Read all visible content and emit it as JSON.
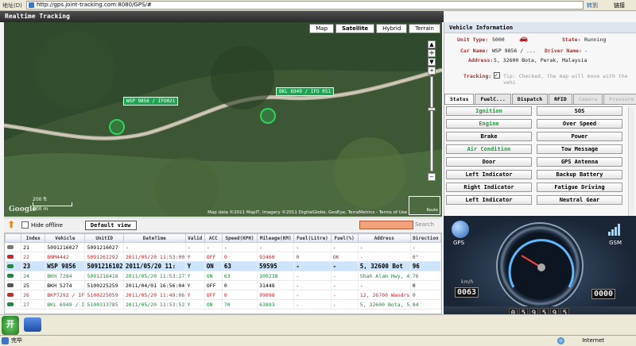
{
  "browser": {
    "address_label": "地址(D)",
    "url": "http://gps.joint-tracking.com:8080/GPS/#",
    "go_label": "转到",
    "links_label": "链接"
  },
  "app": {
    "title": "Realtime Tracking",
    "map_types": [
      "Map",
      "Satellite",
      "Hybrid",
      "Terrain"
    ],
    "map_type_selected": "Satellite",
    "map_vehicles": [
      {
        "label": "WSP 9856 / IFO021"
      },
      {
        "label": "BKL 6949 / IFO 051"
      }
    ],
    "map_scale": {
      "top": "200 ft",
      "bottom": "100 m"
    },
    "map_credit": "Map data ©2011 MapIT, Imagery ©2011 DigitalGlobe, GeoEye, TerraMetrics - Terms of Use",
    "google_logo": "Google",
    "overview_label": "Route"
  },
  "grid": {
    "hide_offline_label": "Hide offline",
    "default_view_label": "Default view",
    "search_label": "Search",
    "columns": [
      "Index",
      "Vehicle",
      "UnitID",
      "DateTime",
      "Valid",
      "ACC",
      "Speed(KPH)",
      "Mileage(KM)",
      "Fuel(Litre)",
      "Fuel(%)",
      "Address",
      "Direction"
    ],
    "rows": [
      {
        "style": "normal",
        "car": "#777777",
        "cells": [
          "21",
          "5091216027",
          "5091216027",
          "-",
          "-",
          "-",
          "-",
          "-",
          "-",
          "-",
          "-",
          "-"
        ]
      },
      {
        "style": "red",
        "car": "#c4282a",
        "cells": [
          "22",
          "BNM4442",
          "5091262292",
          "2011/05/20 11:53:00",
          "Y",
          "OFF",
          "0",
          "93460",
          "0",
          "OK",
          "-",
          "0°"
        ]
      },
      {
        "style": "sel",
        "car": "#1c8a3a",
        "cells": [
          "23",
          "WSP 9856",
          "5091216102",
          "2011/05/20 11:",
          "Y",
          "ON",
          "63",
          "59595",
          "-",
          "-",
          "5, 32600 Bot",
          "96"
        ]
      },
      {
        "style": "green",
        "car": "#1c8a3a",
        "cells": [
          "24",
          "BKH 7284",
          "5091216418",
          "2011/05/20 11:53:27",
          "Y",
          "ON",
          "63",
          "100238",
          "-",
          "-",
          "Shah Alam Hwy, 4",
          "76"
        ]
      },
      {
        "style": "normal",
        "car": "#555555",
        "cells": [
          "25",
          "BKH 5274",
          "5100225259",
          "2011/04/01 16:56:04",
          "Y",
          "OFF",
          "0",
          "31448",
          "-",
          "-",
          "-",
          "0"
        ]
      },
      {
        "style": "red",
        "car": "#c4282a",
        "cells": [
          "26",
          "BKP7292 / IF",
          "5100225059",
          "2011/05/20 11:49:06",
          "Y",
          "OFF",
          "0",
          "99098",
          "-",
          "-",
          "12, 26700 Wandrs",
          "0"
        ]
      },
      {
        "style": "green",
        "car": "#1c8a3a",
        "cells": [
          "27",
          "BKL 6949 / I",
          "5100313785",
          "2011/05/20 11:53:52",
          "Y",
          "ON",
          "70",
          "63883",
          "-",
          "-",
          "5, 32600 Bota, 5",
          "84"
        ]
      }
    ]
  },
  "vehicle_info": {
    "heading": "Vehicle Information",
    "unit_type_key": "Unit Type:",
    "unit_type_val": "5000",
    "state_key": "State:",
    "state_val": "Running",
    "car_name_key": "Car Name:",
    "car_name_val": "WSP 9856 / ...",
    "driver_name_key": "Driver Name:",
    "driver_name_val": "-",
    "address_key": "Address:",
    "address_val": "5, 32600 Bota, Perak, Malaysia",
    "tracking_key": "Tracking:",
    "tracking_tip": "Tip: Checked, the map will move with the vehi"
  },
  "tabs": [
    {
      "label": "Status",
      "state": "on"
    },
    {
      "label": "FuelC...",
      "state": "off"
    },
    {
      "label": "Dispatch",
      "state": "off"
    },
    {
      "label": "RFID",
      "state": "off"
    },
    {
      "label": "Camera",
      "state": "dis"
    },
    {
      "label": "Pressure",
      "state": "dis"
    }
  ],
  "status_items": [
    {
      "label": "Ignition",
      "active": true
    },
    {
      "label": "SOS",
      "active": false
    },
    {
      "label": "Engine",
      "active": true
    },
    {
      "label": "Over Speed",
      "active": false
    },
    {
      "label": "Brake",
      "active": false
    },
    {
      "label": "Power",
      "active": false
    },
    {
      "label": "Air Condition",
      "active": true
    },
    {
      "label": "Tow Message",
      "active": false
    },
    {
      "label": "Door",
      "active": false
    },
    {
      "label": "GPS Antenna",
      "active": false
    },
    {
      "label": "Left Indicator",
      "active": false
    },
    {
      "label": "Backup Battery",
      "active": false
    },
    {
      "label": "Right Indicator",
      "active": false
    },
    {
      "label": "Fatigue Driving",
      "active": false
    },
    {
      "label": "Left Indicator",
      "active": false
    },
    {
      "label": "Neutral Gear",
      "active": false
    }
  ],
  "dashboard": {
    "gps_label": "GPS",
    "gsm_label": "GSM",
    "speed_readout": "0063",
    "speed_unit": "km/h",
    "rpm_readout": "0000",
    "odometer": [
      "0",
      "5",
      "9",
      "5",
      "9",
      "5"
    ]
  },
  "taskbar": {
    "start_label": "开"
  },
  "statusbar": {
    "done": "完毕",
    "zone": "Internet"
  }
}
